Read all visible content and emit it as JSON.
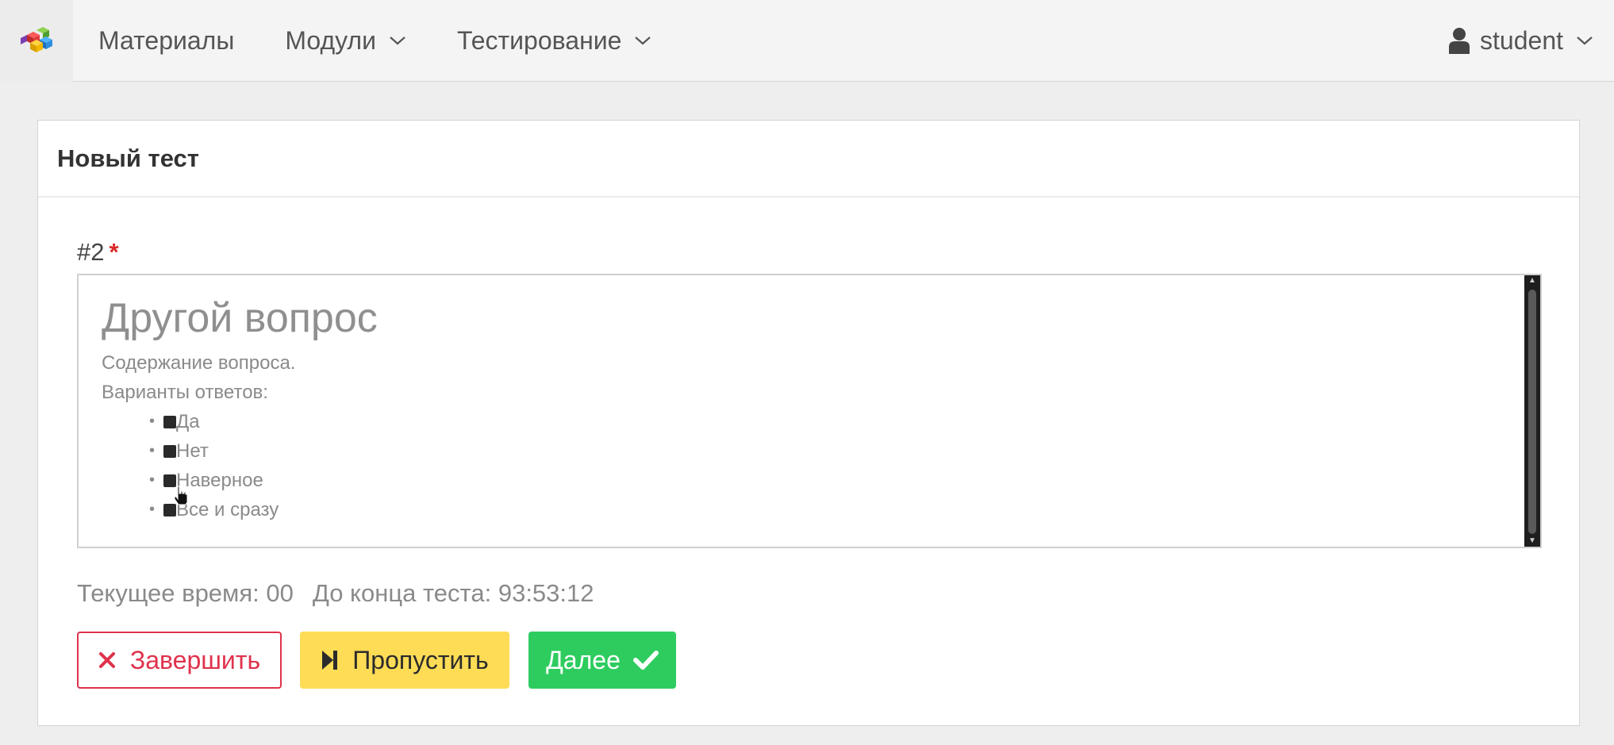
{
  "navbar": {
    "logo_icon": "colored-cubes-logo-icon",
    "items": [
      {
        "label": "Материалы",
        "has_dropdown": false
      },
      {
        "label": "Модули",
        "has_dropdown": true
      },
      {
        "label": "Тестирование",
        "has_dropdown": true
      }
    ],
    "user": {
      "label": "student",
      "icon": "user-icon"
    }
  },
  "card": {
    "title": "Новый тест"
  },
  "question": {
    "number": "#2",
    "required_mark": "*",
    "heading": "Другой вопрос",
    "text": "Содержание вопроса.",
    "options_label": "Варианты ответов:",
    "options": [
      "Да",
      "Нет",
      "Наверное",
      "Все и сразу"
    ]
  },
  "timer": {
    "current_time": "Текущее время: 00",
    "remaining": "До конца теста: 93:53:12"
  },
  "buttons": {
    "finish": "Завершить",
    "skip": "Пропустить",
    "next": "Далее"
  },
  "colors": {
    "finish": "#e0324c",
    "skip": "#fedc56",
    "next": "#2ecc5f",
    "required": "#db2828"
  }
}
